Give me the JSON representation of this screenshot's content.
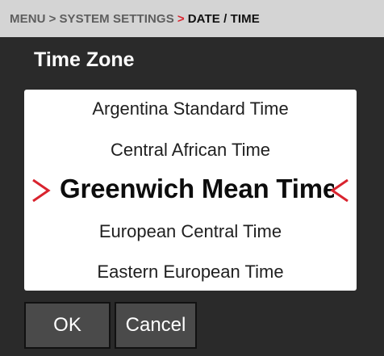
{
  "breadcrumb": {
    "items": [
      "MENU",
      "SYSTEM SETTINGS",
      "DATE / TIME"
    ],
    "separators": [
      ">",
      ">"
    ]
  },
  "page_title": "Time Zone",
  "picker": {
    "options_above": [
      "Argentina Standard Time",
      "Central African Time"
    ],
    "selected": "Greenwich Mean Time",
    "options_below": [
      "European Central Time",
      "Eastern European Time"
    ]
  },
  "buttons": {
    "ok_label": "OK",
    "cancel_label": "Cancel"
  },
  "colors": {
    "accent": "#d9232e",
    "background": "#2a2a2a",
    "breadcrumb_bar": "#d4d4d4",
    "button": "#4a4a4a",
    "picker_background": "#ffffff"
  },
  "icons": {
    "selection_left": "chevron-right-icon",
    "selection_right": "chevron-left-icon"
  }
}
